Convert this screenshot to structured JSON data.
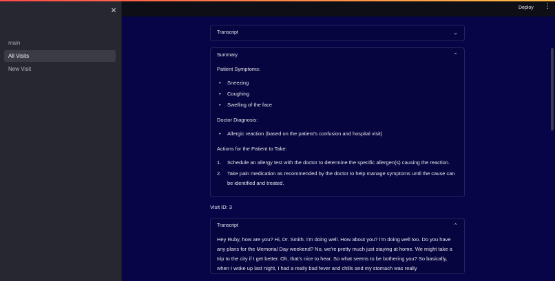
{
  "sidebar": {
    "close_glyph": "×",
    "nav": [
      {
        "label": "main"
      },
      {
        "label": "All Visits"
      },
      {
        "label": "New Visit"
      }
    ]
  },
  "header": {
    "deploy_label": "Deploy",
    "menu_glyph": "⋮"
  },
  "expanders": {
    "transcript_1": {
      "title": "Transcript",
      "chevron": "⌄"
    },
    "summary": {
      "title": "Summary",
      "chevron": "⌃",
      "symptoms_heading": "Patient Symptoms:",
      "symptoms": [
        "Sneezing",
        "Coughing",
        "Swelling of the face"
      ],
      "diagnosis_heading": "Doctor Diagnosis:",
      "diagnosis": [
        "Allergic reaction (based on the patient's confusion and hospital visit)"
      ],
      "actions_heading": "Actions for the Patient to Take:",
      "actions": [
        {
          "num": "1.",
          "text": "Schedule an allergy test with the doctor to determine the specific allergen(s) causing the reaction."
        },
        {
          "num": "2.",
          "text": "Take pain medication as recommended by the doctor to help manage symptoms until the cause can be identified and treated."
        }
      ]
    },
    "visit_id": "Visit ID: 3",
    "transcript_2": {
      "title": "Transcript",
      "chevron": "⌃",
      "text": "Hey Ruby, how are you? Hi, Dr. Smith. I'm doing well. How about you? I'm doing well too. Do you have any plans for the Memorial Day weekend? No, we're pretty much just staying at home. We might take a trip to the city if I get better. Oh, that's nice to hear. So what seems to be bothering you? So basically, when I woke up last night, I had a really bad fever and chills and my stomach was really"
    }
  }
}
